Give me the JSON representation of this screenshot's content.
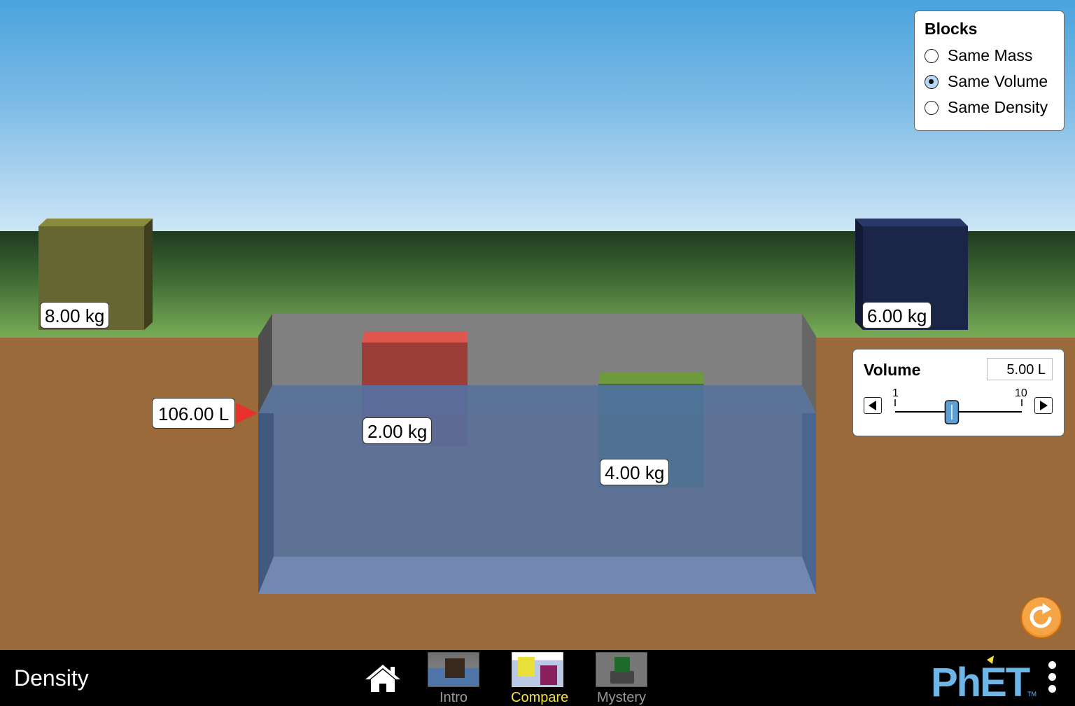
{
  "app": {
    "title": "Density"
  },
  "blocks_panel": {
    "title": "Blocks",
    "options": [
      {
        "label": "Same Mass",
        "selected": false
      },
      {
        "label": "Same Volume",
        "selected": true
      },
      {
        "label": "Same Density",
        "selected": false
      }
    ]
  },
  "volume_panel": {
    "title": "Volume",
    "value_text": "5.00 L",
    "slider_min_label": "1",
    "slider_max_label": "10",
    "slider_value": 5.0
  },
  "pool": {
    "volume_label": "106.00 L"
  },
  "blocks": [
    {
      "name": "yellow-block",
      "color": "#666632",
      "mass_label": "8.00 kg"
    },
    {
      "name": "blue-block",
      "color": "#1a2548",
      "mass_label": "6.00 kg"
    },
    {
      "name": "red-block",
      "color": "#9d3d38",
      "mass_label": "2.00 kg"
    },
    {
      "name": "green-block",
      "color": "#4e6a2e",
      "mass_label": "4.00 kg"
    }
  ],
  "nav": {
    "tabs": [
      {
        "label": "Intro",
        "selected": false
      },
      {
        "label": "Compare",
        "selected": true
      },
      {
        "label": "Mystery",
        "selected": false
      }
    ]
  },
  "icons": {
    "home": "home-icon",
    "reset": "reset-icon",
    "logo": "phet-logo",
    "menu": "menu-dots-icon"
  },
  "colors": {
    "water": "#4f74a8",
    "pool_wall": "#808080",
    "pool_indicator": "#e8312a",
    "reset_button": "#f0962e",
    "selected_tab": "#f2e33b"
  }
}
